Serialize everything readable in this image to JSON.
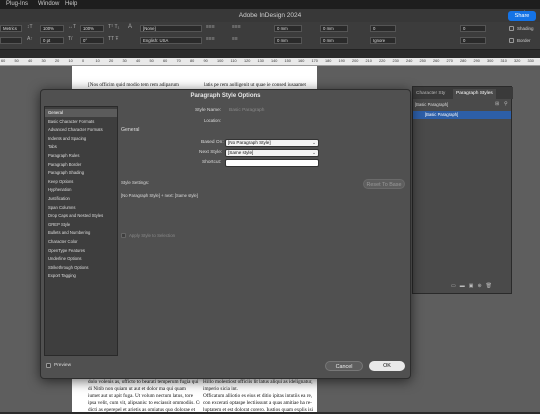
{
  "menubar": {
    "items": [
      "Plug-Ins",
      "Window",
      "Help"
    ]
  },
  "app": {
    "title": "Adobe InDesign 2024",
    "share": "Share"
  },
  "control": {
    "font_style": "Metrics",
    "size_pct1": "100%",
    "size_pct2": "100%",
    "tracking_label": "T",
    "field_0a": "0",
    "field_0b": "0 pt",
    "field_0c": "0°",
    "field_0d": "0°",
    "char_style": "[None]",
    "lang": "English: USA",
    "mm1": "0 mm",
    "mm2": "0 mm",
    "mm3": "0 mm",
    "mm4": "0 mm",
    "num1": "0",
    "num2": "0",
    "ignore": "Ignore",
    "auto": "0",
    "shading": "Shading",
    "border": "Border"
  },
  "ruler": {
    "ticks": [
      "60",
      "50",
      "40",
      "30",
      "20",
      "10",
      "0",
      "10",
      "20",
      "30",
      "40",
      "50",
      "60",
      "70",
      "80",
      "90",
      "100",
      "110",
      "120",
      "130",
      "140",
      "150",
      "160",
      "170",
      "180",
      "190",
      "200",
      "210",
      "220",
      "230",
      "240",
      "250",
      "260",
      "270",
      "280",
      "290",
      "300",
      "310",
      "320",
      "330"
    ]
  },
  "page": {
    "top_left": "[Nos officim quid modio tem rem adiparum",
    "top_right": "latis pe rem aolligenit ut quae ie consed iusaamet",
    "bottom_left": [
      "dolo volenis as, officto to bearati temperum fugia qui",
      "di Nitib non quiam ut aut et dolor ma qui quam",
      "iumet aut ut apit fuga. Ut volum nectum latus, tore",
      "ipsa velit, cum vit, alipsanis: to esciassit ommodiis. Cus",
      "dicti as eperepel et arietis as omiatus quo dolorae et"
    ],
    "bottom_right": [
      "Hillo molestiost officiis lit latus aliqui as idelignatur,",
      "imperio sicia int.",
      "Officatum alliotio es eius et ditio ipitas intutiis ea re,",
      "con excerati optaspe lectiissunt a quas amitiae ha re-",
      "luptatem et est dolorat corero. Iustios quam explis isi"
    ]
  },
  "panel": {
    "tab1": "Character Sty",
    "tab2": "Paragraph Styles",
    "row1": "[Basic Paragraph]",
    "row2": "[Basic Paragraph]"
  },
  "dialog": {
    "title": "Paragraph Style Options",
    "categories": [
      "General",
      "Basic Character Formats",
      "Advanced Character Formats",
      "Indents and Spacing",
      "Tabs",
      "Paragraph Rules",
      "Paragraph Border",
      "Paragraph Shading",
      "Keep Options",
      "Hyphenation",
      "Justification",
      "Span Columns",
      "Drop Caps and Nested Styles",
      "GREP Style",
      "Bullets and Numbering",
      "Character Color",
      "OpenType Features",
      "Underline Options",
      "Strikethrough Options",
      "Export Tagging"
    ],
    "style_name_label": "Style Name:",
    "style_name_value": "Basic Paragraph",
    "location_label": "Location:",
    "section": "General",
    "based_on_label": "Based On:",
    "based_on_value": "[No Paragraph Style]",
    "next_style_label": "Next Style:",
    "next_style_value": "[Same style]",
    "shortcut_label": "Shortcut:",
    "settings_label": "Style Settings:",
    "reset": "Reset To Base",
    "settings_text": "[No Paragraph Style] + next: [Same style]",
    "apply_label": "Apply Style to Selection",
    "preview_label": "Preview",
    "cancel": "Cancel",
    "ok": "OK"
  },
  "colors": {
    "accent": "#1473e6",
    "dialog_bg": "#505050"
  }
}
